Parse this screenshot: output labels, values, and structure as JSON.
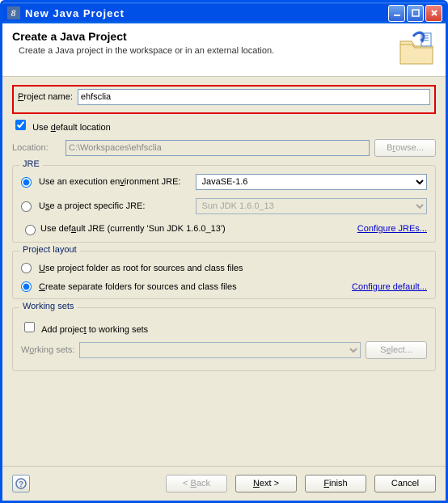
{
  "window": {
    "title": "New Java Project"
  },
  "header": {
    "title": "Create a Java Project",
    "subtitle": "Create a Java project in the workspace or in an external location."
  },
  "project": {
    "name_label": "Project name:",
    "name_value": "ehfsclia",
    "use_default_label": "Use default location",
    "use_default_checked": true,
    "location_label": "Location:",
    "location_value": "C:\\Workspaces\\ehfsclia",
    "browse_label": "Browse..."
  },
  "jre": {
    "group_title": "JRE",
    "opt_exec_env": "Use an execution environment JRE:",
    "exec_env_value": "JavaSE-1.6",
    "opt_project_specific": "Use a project specific JRE:",
    "project_specific_value": "Sun JDK 1.6.0_13",
    "opt_default": "Use default JRE (currently 'Sun JDK 1.6.0_13')",
    "configure_link": "Configure JREs...",
    "selected": "exec_env"
  },
  "layout": {
    "group_title": "Project layout",
    "opt_root": "Use project folder as root for sources and class files",
    "opt_separate": "Create separate folders for sources and class files",
    "configure_link": "Configure default...",
    "selected": "separate"
  },
  "working_sets": {
    "group_title": "Working sets",
    "add_label": "Add project to working sets",
    "add_checked": false,
    "ws_label": "Working sets:",
    "select_label": "Select..."
  },
  "footer": {
    "back": "< Back",
    "next": "Next >",
    "finish": "Finish",
    "cancel": "Cancel"
  }
}
